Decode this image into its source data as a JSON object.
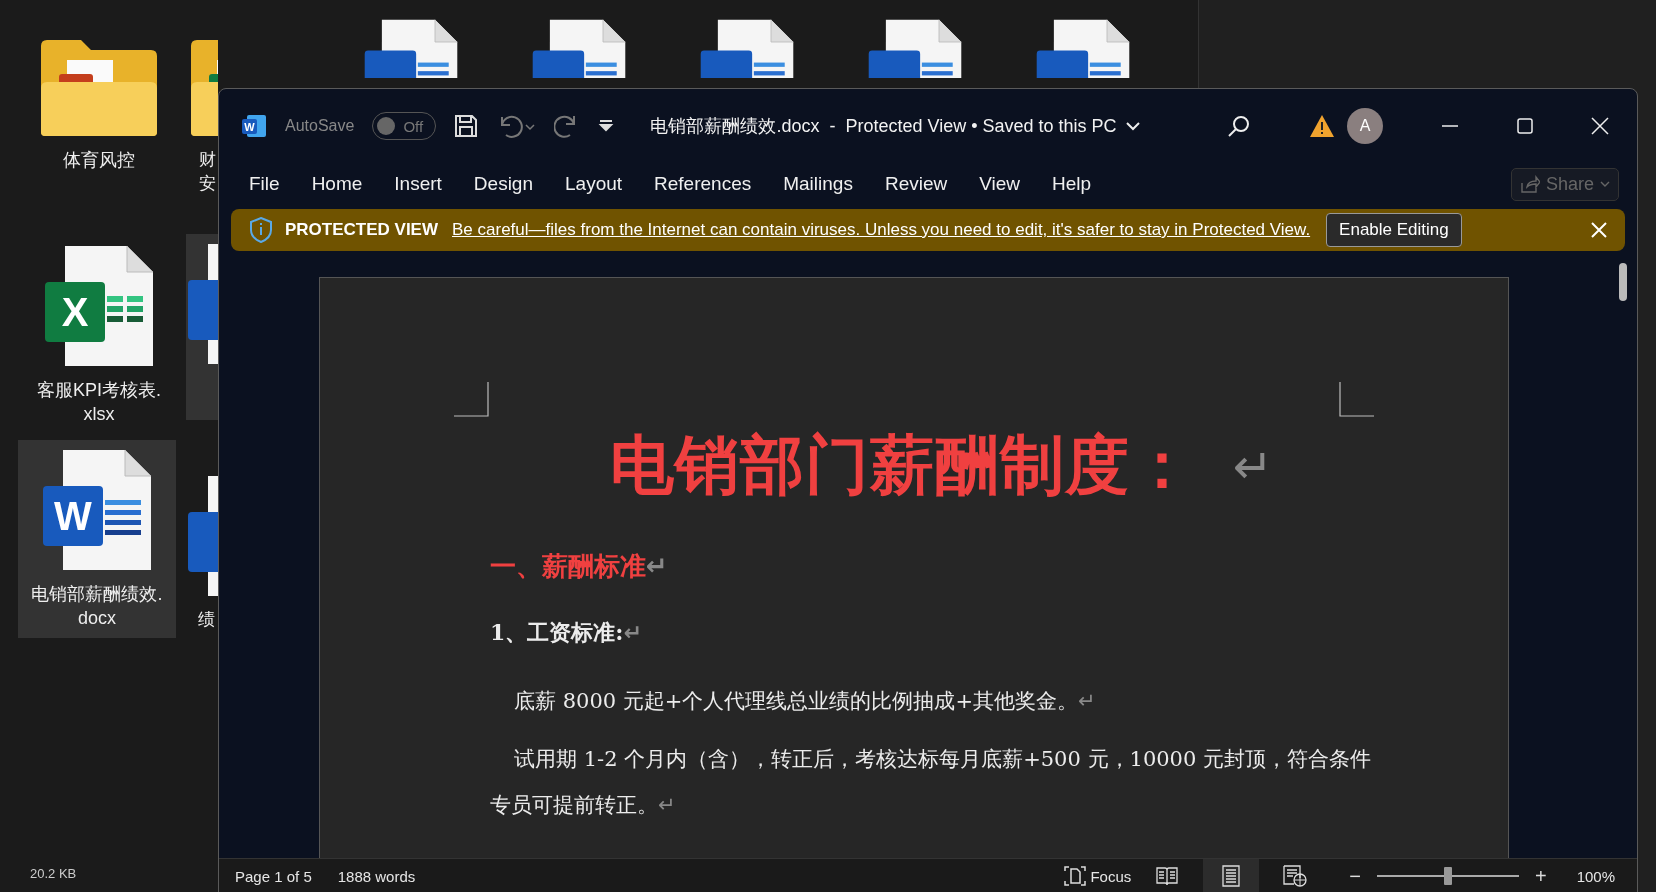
{
  "desktop": {
    "icons": [
      {
        "kind": "ppt-folder",
        "label_lines": [
          "体育风控"
        ],
        "selected": false
      },
      {
        "kind": "excel-folder",
        "label_lines": [
          "财",
          "安"
        ],
        "selected": false
      },
      {
        "kind": "word",
        "selected": false
      },
      {
        "kind": "word",
        "selected": false
      },
      {
        "kind": "word",
        "selected": false
      },
      {
        "kind": "word",
        "selected": false
      },
      {
        "kind": "word",
        "selected": false
      },
      {
        "kind": "excel",
        "badge": "X",
        "label_lines": [
          "客服KPI考核表.",
          "xlsx"
        ],
        "selected": false
      },
      {
        "kind": "word",
        "selected": true
      },
      {
        "kind": "word",
        "badge": "W",
        "label_lines": [
          "电销部薪酬绩效.",
          "docx"
        ],
        "selected": true
      },
      {
        "kind": "word",
        "label_lines": [
          "绩"
        ],
        "selected": false
      }
    ],
    "status_text": "20.2 KB"
  },
  "window": {
    "app_logo": "W",
    "autosave": {
      "label": "AutoSave",
      "on": false,
      "state_text": "Off"
    },
    "title": "电销部薪酬绩效.docx  -  Protected View • Saved to this PC",
    "avatar": "A"
  },
  "tabs": [
    {
      "label": "File",
      "selected": false
    },
    {
      "label": "Home",
      "selected": false
    },
    {
      "label": "Insert",
      "selected": false
    },
    {
      "label": "Design",
      "selected": false
    },
    {
      "label": "Layout",
      "selected": false
    },
    {
      "label": "References",
      "selected": false
    },
    {
      "label": "Mailings",
      "selected": false
    },
    {
      "label": "Review",
      "selected": false
    },
    {
      "label": "View",
      "selected": false
    },
    {
      "label": "Help",
      "selected": false
    }
  ],
  "share": {
    "label": "Share",
    "disabled": true
  },
  "protected_bar": {
    "title": "PROTECTED VIEW",
    "message": "Be careful—files from the Internet can contain viruses. Unless you need to edit, it's safer to stay in Protected View.",
    "button": "Enable Editing"
  },
  "document": {
    "paragraphs": [
      {
        "kind": "title",
        "text": "电销部门薪酬制度：",
        "mark": "↵"
      },
      {
        "kind": "heading",
        "text": "一、薪酬标准",
        "mark": "↵"
      },
      {
        "kind": "subheading",
        "text": "1、工资标准:",
        "mark": "↵"
      },
      {
        "kind": "body",
        "text": "底薪 8000 元起+个人代理线总业绩的比例抽成+其他奖金。",
        "mark": "↵"
      },
      {
        "kind": "body",
        "text": "试用期 1-2 个月内（含），转正后，考核达标每月底薪+500 元，10000 元封顶，符合条件专员可提前转正。",
        "mark": "↵"
      }
    ]
  },
  "status_bar": {
    "page": "Page 1 of 5",
    "words": "1888 words",
    "focus": "Focus",
    "views": [
      {
        "kind": "read",
        "selected": false
      },
      {
        "kind": "print",
        "selected": true
      },
      {
        "kind": "web",
        "selected": false
      }
    ],
    "zoom": {
      "minus": "−",
      "plus": "+",
      "level": 0.5,
      "reading": "100%"
    }
  }
}
